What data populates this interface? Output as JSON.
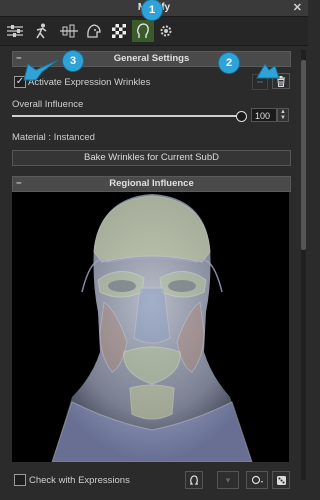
{
  "window": {
    "title": "Modify",
    "close_glyph": "✕"
  },
  "toolbar": {
    "buttons": [
      {
        "icon": "sliders-icon"
      },
      {
        "icon": "motion-figure-icon"
      },
      {
        "icon": "align-icon"
      },
      {
        "icon": "face-tool-icon"
      },
      {
        "icon": "checker-texture-icon"
      },
      {
        "icon": "head-morph-icon",
        "active": true
      },
      {
        "icon": "gear-cog-icon"
      }
    ]
  },
  "badges": {
    "one": "1",
    "two": "2",
    "three": "3"
  },
  "general_settings": {
    "header": "General Settings",
    "collapse_glyph": "−",
    "activate_label": "Activate Expression Wrinkles",
    "activate_checked": true,
    "check_glyph": "✓",
    "overall_influence_label": "Overall Influence",
    "overall_influence_value": "100",
    "material_label": "Material : Instanced",
    "bake_button_label": "Bake Wrinkles for Current SubD"
  },
  "regional_influence": {
    "header": "Regional Influence",
    "collapse_glyph": "−"
  },
  "bottom": {
    "check_expressions_label": "Check with Expressions",
    "check_expressions_checked": false
  },
  "colors": {
    "accent_badge": "#2fa3d8",
    "panel_bg": "#2b2b2b",
    "header_bg": "#4a4a4a"
  }
}
